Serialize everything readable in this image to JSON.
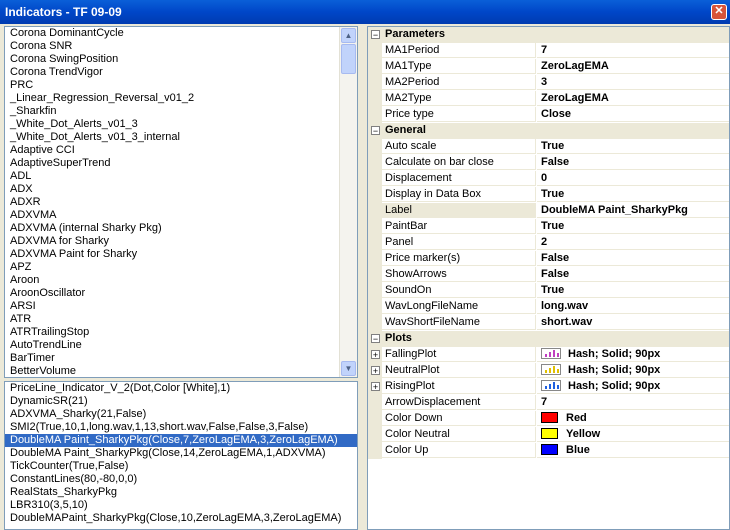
{
  "window": {
    "title": "Indicators - TF 09-09"
  },
  "indicator_list": [
    "Corona DominantCycle",
    "Corona SNR",
    "Corona SwingPosition",
    "Corona TrendVigor",
    "PRC",
    "_Linear_Regression_Reversal_v01_2",
    "_Sharkfin",
    "_White_Dot_Alerts_v01_3",
    "_White_Dot_Alerts_v01_3_internal",
    "Adaptive CCI",
    "AdaptiveSuperTrend",
    "ADL",
    "ADX",
    "ADXR",
    "ADXVMA",
    "ADXVMA (internal Sharky Pkg)",
    "ADXVMA for Sharky",
    "ADXVMA Paint for Sharky",
    "APZ",
    "Aroon",
    "AroonOscillator",
    "ARSI",
    "ATR",
    "ATRTrailingStop",
    "AutoTrendLine",
    "BarTimer",
    "BetterVolume"
  ],
  "applied_list": [
    "PriceLine_Indicator_V_2(Dot,Color [White],1)",
    "DynamicSR(21)",
    "ADXVMA_Sharky(21,False)",
    "SMI2(True,10,1,long.wav,1,13,short.wav,False,False,3,False)",
    "DoubleMA Paint_SharkyPkg(Close,7,ZeroLagEMA,3,ZeroLagEMA)",
    "DoubleMA Paint_SharkyPkg(Close,14,ZeroLagEMA,1,ADXVMA)",
    "TickCounter(True,False)",
    "ConstantLines(80,-80,0,0)",
    "RealStats_SharkyPkg",
    "LBR310(3,5,10)",
    "DoubleMAPaint_SharkyPkg(Close,10,ZeroLagEMA,3,ZeroLagEMA)"
  ],
  "applied_selected_index": 4,
  "properties": {
    "parameters": {
      "label": "Parameters",
      "rows": [
        {
          "name": "MA1Period",
          "value": "7"
        },
        {
          "name": "MA1Type",
          "value": "ZeroLagEMA"
        },
        {
          "name": "MA2Period",
          "value": "3"
        },
        {
          "name": "MA2Type",
          "value": "ZeroLagEMA"
        },
        {
          "name": "Price type",
          "value": "Close"
        }
      ]
    },
    "general": {
      "label": "General",
      "rows": [
        {
          "name": "Auto scale",
          "value": "True"
        },
        {
          "name": "Calculate on bar close",
          "value": "False"
        },
        {
          "name": "Displacement",
          "value": "0"
        },
        {
          "name": "Display in Data Box",
          "value": "True"
        },
        {
          "name": "Label",
          "value": "DoubleMA Paint_SharkyPkg"
        },
        {
          "name": "PaintBar",
          "value": "True"
        },
        {
          "name": "Panel",
          "value": "2"
        },
        {
          "name": "Price marker(s)",
          "value": "False"
        },
        {
          "name": "ShowArrows",
          "value": "False"
        },
        {
          "name": "SoundOn",
          "value": "True"
        },
        {
          "name": "WavLongFileName",
          "value": "long.wav"
        },
        {
          "name": "WavShortFileName",
          "value": "short.wav"
        }
      ]
    },
    "plots": {
      "label": "Plots",
      "rows": [
        {
          "name": "FallingPlot",
          "value": "Hash; Solid; 90px",
          "icon_color": "#c040c0"
        },
        {
          "name": "NeutralPlot",
          "value": "Hash; Solid; 90px",
          "icon_color": "#e0c000"
        },
        {
          "name": "RisingPlot",
          "value": "Hash; Solid; 90px",
          "icon_color": "#2060e0"
        },
        {
          "name": "ArrowDisplacement",
          "value": "7"
        },
        {
          "name": "Color Down",
          "value": "Red",
          "color": "#ff0000"
        },
        {
          "name": "Color Neutral",
          "value": "Yellow",
          "color": "#ffff00"
        },
        {
          "name": "Color Up",
          "value": "Blue",
          "color": "#0000ff"
        }
      ]
    }
  }
}
